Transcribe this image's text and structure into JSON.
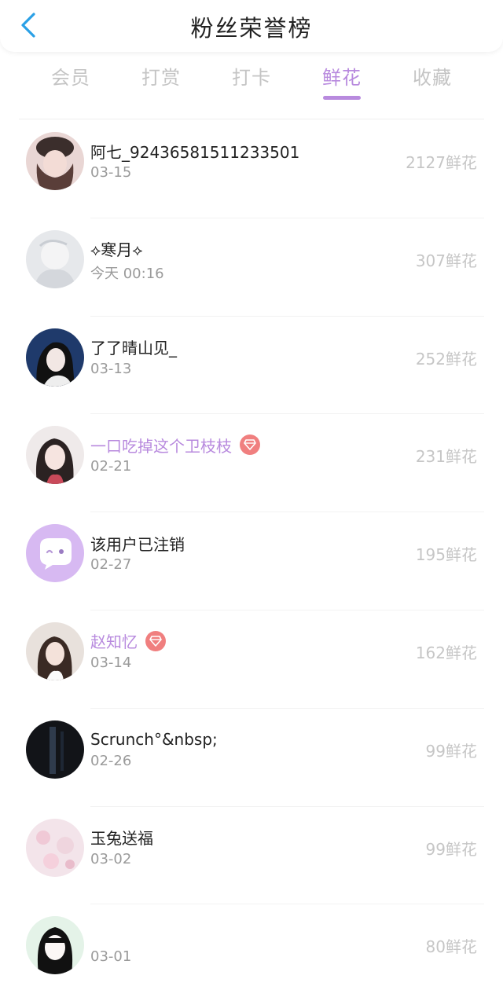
{
  "header": {
    "title": "粉丝荣誉榜"
  },
  "tabs": [
    {
      "label": "会员",
      "active": false
    },
    {
      "label": "打赏",
      "active": false
    },
    {
      "label": "打卡",
      "active": false
    },
    {
      "label": "鲜花",
      "active": true
    },
    {
      "label": "收藏",
      "active": false
    }
  ],
  "colors": {
    "accent": "#b88ade",
    "vip_badge": "#f07f7f",
    "back_arrow": "#2aa0e6"
  },
  "ranking": [
    {
      "name": "阿七_92436581511233501",
      "date": "03-15",
      "score": "2127鲜花",
      "vip": false
    },
    {
      "name": "⟡寒月⟡",
      "date": "今天 00:16",
      "score": "307鲜花",
      "vip": false
    },
    {
      "name": "了了晴山见_",
      "date": "03-13",
      "score": "252鲜花",
      "vip": false
    },
    {
      "name": "一口吃掉这个卫枝枝",
      "date": "02-21",
      "score": "231鲜花",
      "vip": true
    },
    {
      "name": "该用户已注销",
      "date": "02-27",
      "score": "195鲜花",
      "vip": false
    },
    {
      "name": "赵知忆",
      "date": "03-14",
      "score": "162鲜花",
      "vip": true
    },
    {
      "name": "Scrunch°&nbsp;",
      "date": "02-26",
      "score": "99鲜花",
      "vip": false
    },
    {
      "name": "玉兔送福",
      "date": "03-02",
      "score": "99鲜花",
      "vip": false
    },
    {
      "name": "",
      "date": "03-01",
      "score": "80鲜花",
      "vip": false
    }
  ]
}
